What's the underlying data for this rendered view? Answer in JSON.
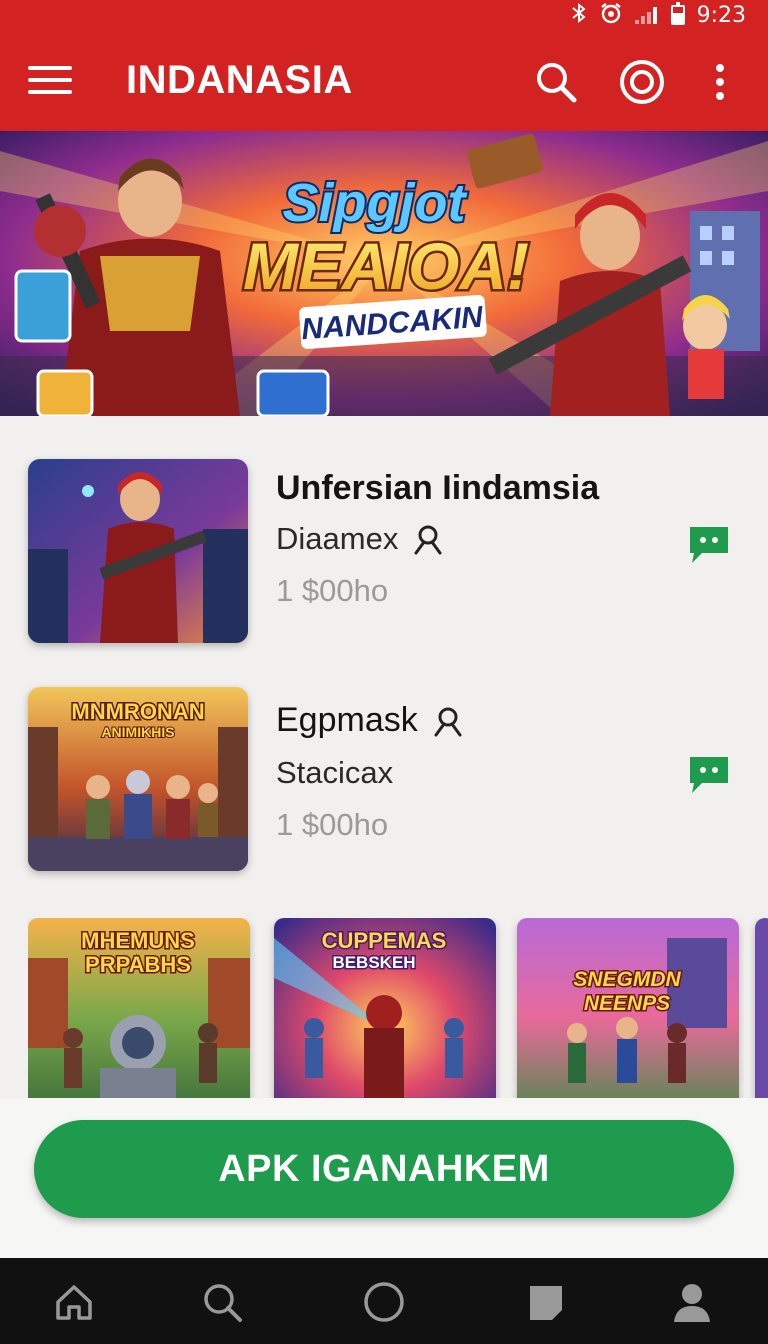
{
  "status_bar": {
    "time": "9:23",
    "icons": [
      "bluetooth-icon",
      "alarm-icon",
      "signal-icon",
      "battery-icon"
    ]
  },
  "app_bar": {
    "title": "INDANASIA",
    "actions": [
      "menu-icon",
      "search-icon",
      "target-icon",
      "more-vert-icon"
    ]
  },
  "hero": {
    "headline_1": "Sipgjot",
    "headline_2": "MEAIOA!",
    "tagline": "NANDCAKIN"
  },
  "list": [
    {
      "title": "Unfersian Iindamsia",
      "subtitle": "Diaamex",
      "price": "1 $00ho"
    },
    {
      "title": "Egpmask",
      "subtitle": "Stacicax",
      "price": "1 $00ho"
    }
  ],
  "thumb_labels": {
    "item_2_line_1": "MNMRONAN",
    "item_2_line_2": "ANIMIKHIS"
  },
  "carousel": [
    {
      "line_1": "MHEMUNS",
      "line_2": "PRPABHS"
    },
    {
      "line_1": "CUPPEMAS",
      "line_2": "BEBSKEH"
    },
    {
      "line_1": "SNEGMDN",
      "line_2": "NEENPS"
    }
  ],
  "cta": {
    "label": "APK IGANAHKEM"
  },
  "bottom_nav": [
    "home-icon",
    "search-icon",
    "circle-icon",
    "chat-icon",
    "profile-icon"
  ],
  "colors": {
    "primary": "#d32222",
    "accent_green": "#1e9b4c",
    "background": "#f1f0ee",
    "nav_bar": "#111111"
  }
}
